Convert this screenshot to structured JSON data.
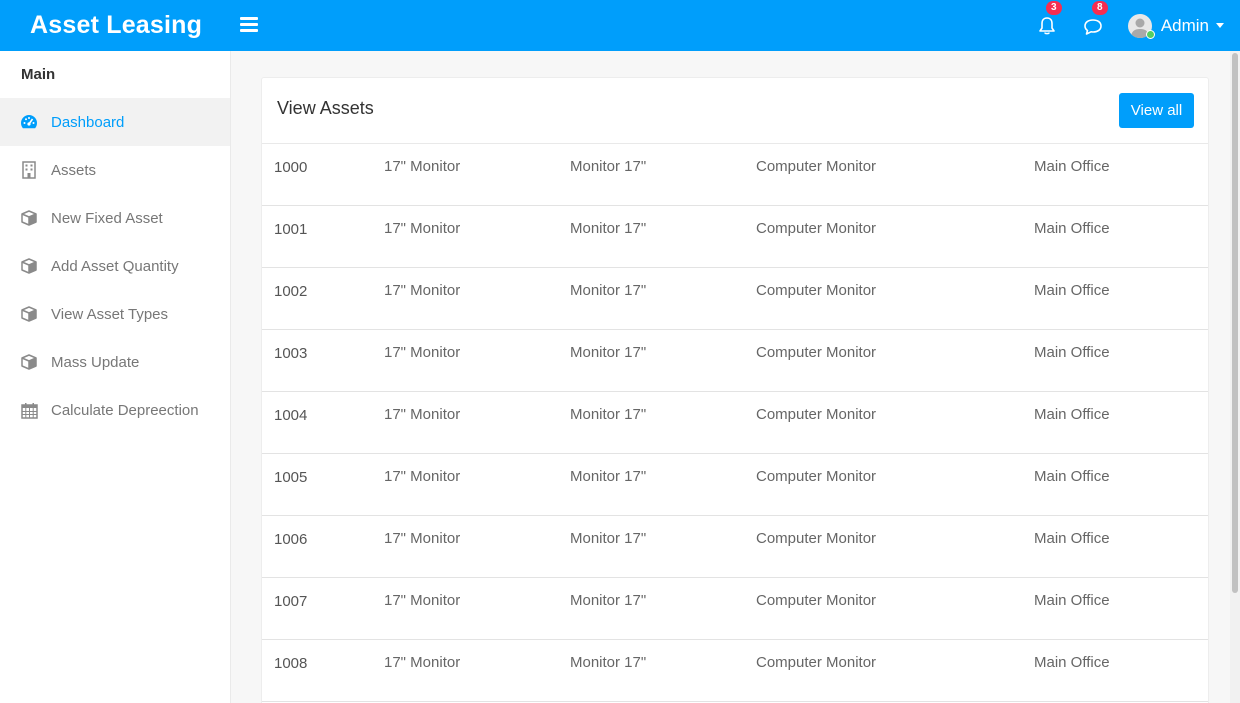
{
  "header": {
    "brand": "Asset Leasing",
    "notifications_count": "3",
    "messages_count": "8",
    "user_name": "Admin"
  },
  "sidebar": {
    "section_title": "Main",
    "items": [
      {
        "label": "Dashboard",
        "icon": "dashboard-icon",
        "active": true
      },
      {
        "label": "Assets",
        "icon": "building-icon"
      },
      {
        "label": "New Fixed Asset",
        "icon": "cube-icon"
      },
      {
        "label": "Add Asset Quantity",
        "icon": "cube-icon"
      },
      {
        "label": "View Asset Types",
        "icon": "cube-icon"
      },
      {
        "label": "Mass Update",
        "icon": "cube-icon"
      },
      {
        "label": "Calculate Depreection",
        "icon": "calendar-icon"
      }
    ]
  },
  "main": {
    "title": "View Assets",
    "view_all_label": "View all",
    "rows": [
      [
        "1000",
        "17\" Monitor",
        "Monitor 17\"",
        "Computer Monitor",
        "Main Office"
      ],
      [
        "1001",
        "17\" Monitor",
        "Monitor 17\"",
        "Computer Monitor",
        "Main Office"
      ],
      [
        "1002",
        "17\" Monitor",
        "Monitor 17\"",
        "Computer Monitor",
        "Main Office"
      ],
      [
        "1003",
        "17\" Monitor",
        "Monitor 17\"",
        "Computer Monitor",
        "Main Office"
      ],
      [
        "1004",
        "17\" Monitor",
        "Monitor 17\"",
        "Computer Monitor",
        "Main Office"
      ],
      [
        "1005",
        "17\" Monitor",
        "Monitor 17\"",
        "Computer Monitor",
        "Main Office"
      ],
      [
        "1006",
        "17\" Monitor",
        "Monitor 17\"",
        "Computer Monitor",
        "Main Office"
      ],
      [
        "1007",
        "17\" Monitor",
        "Monitor 17\"",
        "Computer Monitor",
        "Main Office"
      ],
      [
        "1008",
        "17\" Monitor",
        "Monitor 17\"",
        "Computer Monitor",
        "Main Office"
      ]
    ]
  },
  "colors": {
    "primary": "#009efb",
    "badge": "#f62d51",
    "online": "#55ce63"
  }
}
